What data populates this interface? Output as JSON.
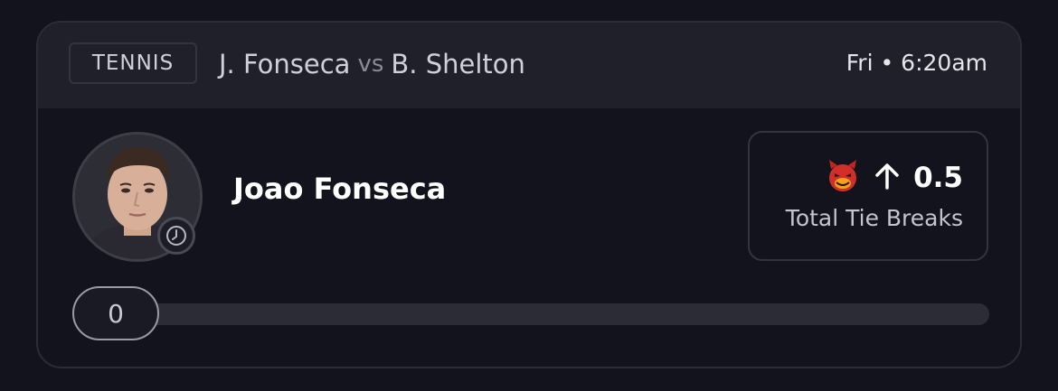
{
  "card": {
    "sport": "TENNIS",
    "player1": "J. Fonseca",
    "vs": "vs",
    "player2": "B. Shelton",
    "start_time": "Fri • 6:20am",
    "player_name": "Joao Fonseca",
    "avatar_icon": "player-headshot",
    "status_icon": "clock-icon",
    "prop": {
      "badge_icon": "devil-emoji-icon",
      "direction_icon": "arrow-up-icon",
      "line": "0.5",
      "stat": "Total Tie Breaks"
    },
    "progress": {
      "value": "0",
      "fraction": 0
    }
  },
  "colors": {
    "background": "#13131d",
    "header": "#20202b",
    "border": "#2c2c37",
    "text": "#ffffff",
    "muted": "#8b8b96"
  }
}
